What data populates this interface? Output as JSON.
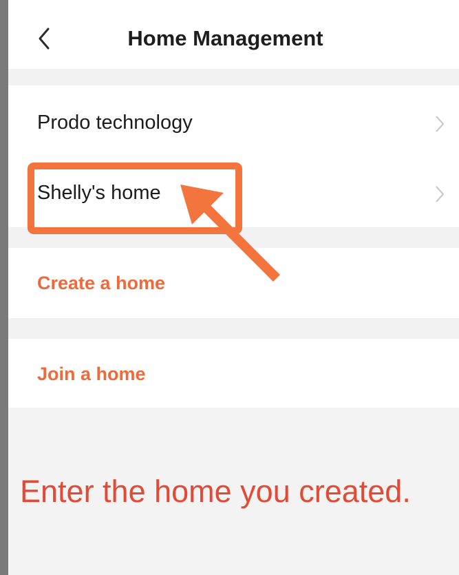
{
  "header": {
    "title": "Home Management",
    "back_icon": "chevron-left-icon"
  },
  "homes": [
    {
      "name": "Prodo technology"
    },
    {
      "name": "Shelly's home"
    }
  ],
  "actions": {
    "create_home": "Create a home",
    "join_home": "Join a home"
  },
  "annotation": {
    "caption": "Enter the home you created.",
    "highlight_color": "#f4743d"
  },
  "colors": {
    "accent": "#ef6a3a",
    "caption": "#e24a35"
  }
}
